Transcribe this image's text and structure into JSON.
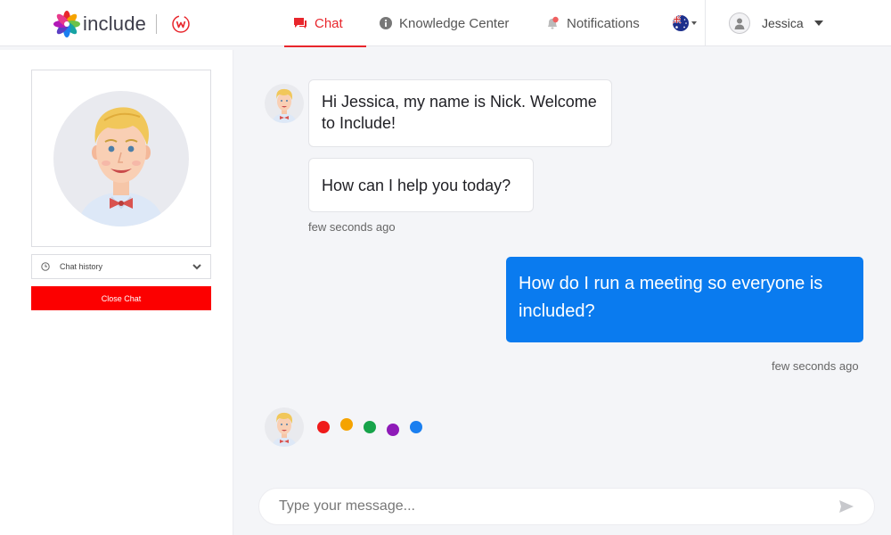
{
  "header": {
    "brand": "include",
    "tabs": [
      {
        "label": "Chat",
        "icon": "chat-bubble-icon",
        "active": true
      },
      {
        "label": "Knowledge Center",
        "icon": "info-icon",
        "active": false
      },
      {
        "label": "Notifications",
        "icon": "bell-icon",
        "active": false
      }
    ],
    "language_flag": "australia-flag-icon",
    "user": {
      "name": "Jessica"
    }
  },
  "sidebar": {
    "chat_history_label": "Chat history",
    "close_chat_label": "Close Chat"
  },
  "conversation": {
    "bot_messages": [
      "Hi Jessica, my name is Nick. Welcome to Include!",
      "How can I help you today?"
    ],
    "bot_timestamp": "few seconds ago",
    "user_message": "How do I run a meeting so everyone is included?",
    "user_timestamp": "few seconds ago",
    "typing_indicator_colors": [
      "#ef1b1b",
      "#f5a300",
      "#17a34a",
      "#8e1ab8",
      "#1a7ff0"
    ]
  },
  "composer": {
    "placeholder": "Type your message..."
  },
  "colors": {
    "accent": "#e8262c",
    "user_bubble": "#0a7bef",
    "close_button": "#fc0000"
  }
}
